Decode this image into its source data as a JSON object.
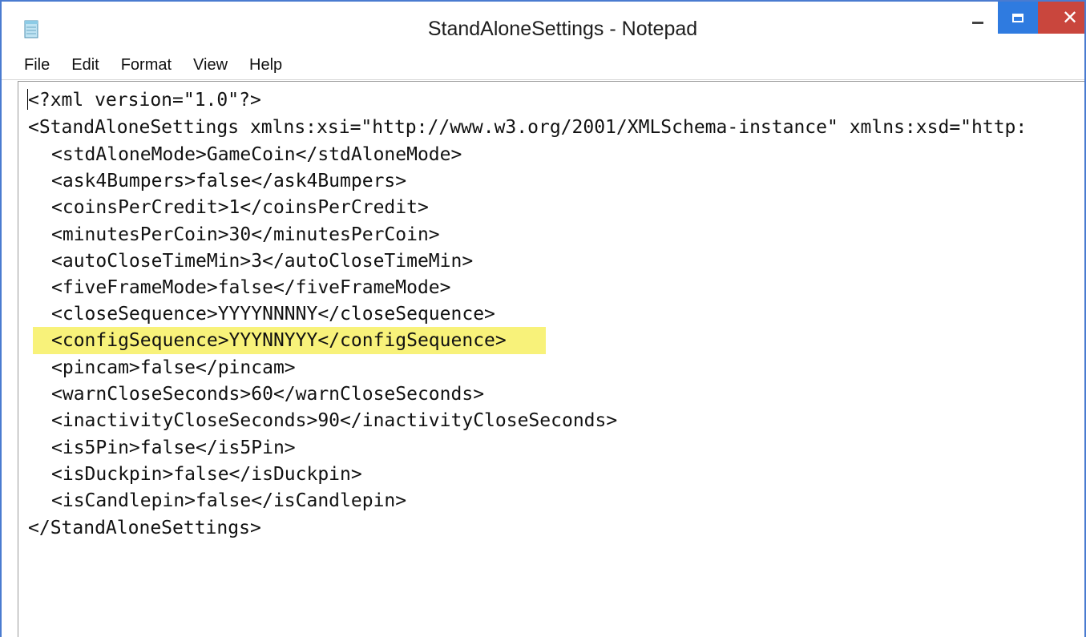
{
  "window": {
    "title": "StandAloneSettings - Notepad",
    "controls": {
      "minimize": "minimize",
      "maximize": "maximize",
      "close_glyph": "✕"
    }
  },
  "menu": {
    "items": [
      "File",
      "Edit",
      "Format",
      "View",
      "Help"
    ]
  },
  "editor": {
    "highlight_color": "#f8f27a",
    "highlighted_line": 9,
    "lines": [
      "<?xml version=\"1.0\"?>",
      "<StandAloneSettings xmlns:xsi=\"http://www.w3.org/2001/XMLSchema-instance\" xmlns:xsd=\"http:",
      "<stdAloneMode>GameCoin</stdAloneMode>",
      "<ask4Bumpers>false</ask4Bumpers>",
      "<coinsPerCredit>1</coinsPerCredit>",
      "<minutesPerCoin>30</minutesPerCoin>",
      "<autoCloseTimeMin>3</autoCloseTimeMin>",
      "<fiveFrameMode>false</fiveFrameMode>",
      "<closeSequence>YYYYNNNNY</closeSequence>",
      "<configSequence>YYYNNYYY</configSequence>",
      "<pincam>false</pincam>",
      "<warnCloseSeconds>60</warnCloseSeconds>",
      "<inactivityCloseSeconds>90</inactivityCloseSeconds>",
      "<is5Pin>false</is5Pin>",
      "<isDuckpin>false</isDuckpin>",
      "<isCandlepin>false</isCandlepin>",
      "</StandAloneSettings>"
    ]
  }
}
